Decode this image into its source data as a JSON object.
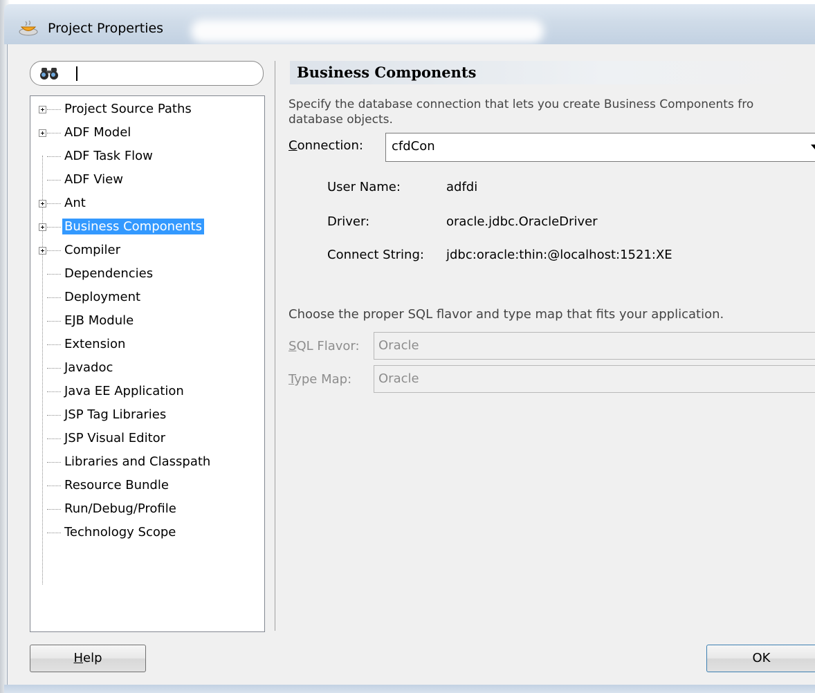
{
  "window": {
    "title": "Project Properties"
  },
  "search": {
    "value": ""
  },
  "tree": {
    "items": [
      {
        "label": "Project Source Paths",
        "expandable": true
      },
      {
        "label": "ADF Model",
        "expandable": true
      },
      {
        "label": "ADF Task Flow",
        "expandable": false
      },
      {
        "label": "ADF View",
        "expandable": false
      },
      {
        "label": "Ant",
        "expandable": true
      },
      {
        "label": "Business Components",
        "expandable": true,
        "selected": true
      },
      {
        "label": "Compiler",
        "expandable": true
      },
      {
        "label": "Dependencies",
        "expandable": false
      },
      {
        "label": "Deployment",
        "expandable": false
      },
      {
        "label": "EJB Module",
        "expandable": false
      },
      {
        "label": "Extension",
        "expandable": false
      },
      {
        "label": "Javadoc",
        "expandable": false
      },
      {
        "label": "Java EE Application",
        "expandable": false
      },
      {
        "label": "JSP Tag Libraries",
        "expandable": false
      },
      {
        "label": "JSP Visual Editor",
        "expandable": false
      },
      {
        "label": "Libraries and Classpath",
        "expandable": false
      },
      {
        "label": "Resource Bundle",
        "expandable": false
      },
      {
        "label": "Run/Debug/Profile",
        "expandable": false
      },
      {
        "label": "Technology Scope",
        "expandable": false
      }
    ]
  },
  "panel": {
    "title": "Business Components",
    "description_line1": "Specify the database connection that lets you create Business Components fro",
    "description_line2": "database objects.",
    "connection_label": "Connection:",
    "connection_value": "cfdCon",
    "user_name_label": "User Name:",
    "user_name_value": "adfdi",
    "driver_label": "Driver:",
    "driver_value": "oracle.jdbc.OracleDriver",
    "connect_string_label": "Connect String:",
    "connect_string_value": "jdbc:oracle:thin:@localhost:1521:XE",
    "flavor_hint": "Choose the proper SQL flavor and type map that fits your application.",
    "sql_flavor_label": "SQL Flavor:",
    "sql_flavor_value": "Oracle",
    "type_map_label": "Type Map:",
    "type_map_value": "Oracle"
  },
  "buttons": {
    "help": "Help",
    "ok": "OK"
  }
}
